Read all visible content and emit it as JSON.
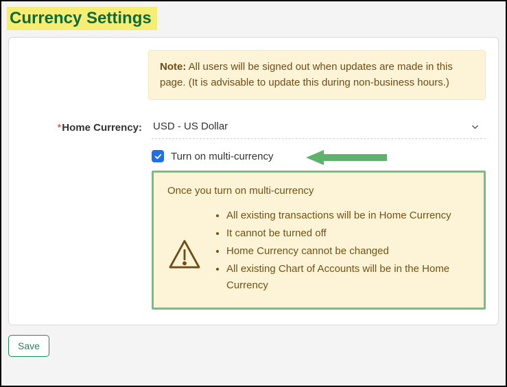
{
  "page": {
    "title": "Currency Settings"
  },
  "note": {
    "label": "Note:",
    "text": "All users will be signed out when updates are made in this page. (It is advisable to update this during non-business hours.)"
  },
  "form": {
    "home_currency_label": "Home Currency:",
    "home_currency_value": "USD - US Dollar",
    "multi_currency_label": "Turn on multi-currency",
    "multi_currency_checked": true
  },
  "warning": {
    "heading": "Once you turn on multi-currency",
    "items": [
      "All existing transactions will be in Home Currency",
      "It cannot be turned off",
      "Home Currency cannot be changed",
      "All existing Chart of Accounts will be in the Home Currency"
    ]
  },
  "actions": {
    "save": "Save"
  }
}
